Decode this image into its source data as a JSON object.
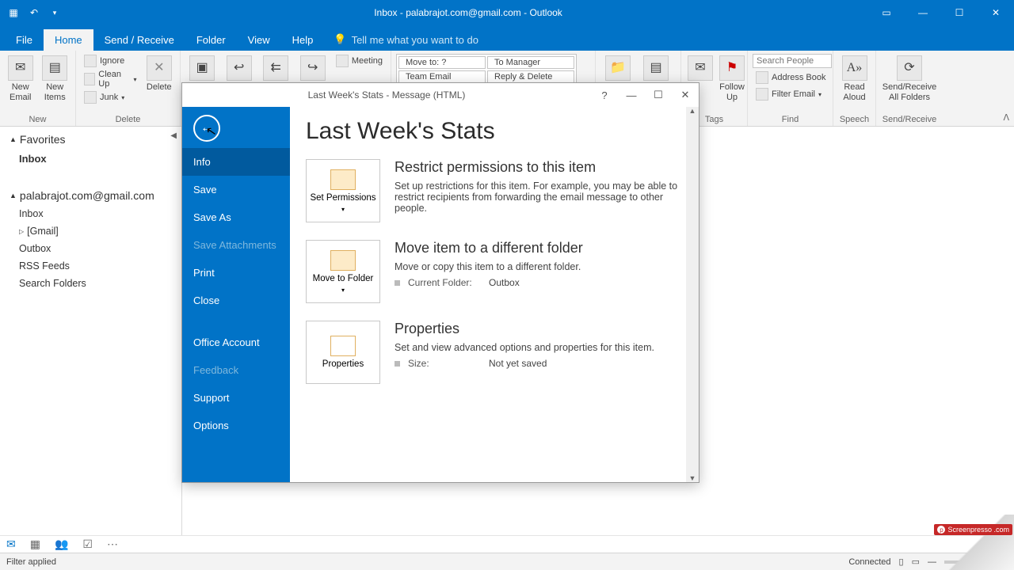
{
  "title": "Inbox - palabrajot.com@gmail.com - Outlook",
  "tabs": {
    "file": "File",
    "home": "Home",
    "sendreceive": "Send / Receive",
    "folder": "Folder",
    "view": "View",
    "help": "Help",
    "tellme": "Tell me what you want to do"
  },
  "ribbon": {
    "new": {
      "email": "New Email",
      "items": "New Items",
      "label": "New"
    },
    "delete": {
      "ignore": "Ignore",
      "cleanup": "Clean Up",
      "junk": "Junk",
      "delete": "Delete",
      "label": "Delete"
    },
    "respond": {
      "meeting": "Meeting"
    },
    "quicksteps": {
      "moveto": "Move to: ?",
      "tomanager": "To Manager",
      "teamemail": "Team Email",
      "replydelete": "Reply & Delete"
    },
    "tags": {
      "followup": "Follow Up",
      "label": "Tags"
    },
    "find": {
      "search_ph": "Search People",
      "addressbook": "Address Book",
      "filter": "Filter Email",
      "label": "Find"
    },
    "speech": {
      "read": "Read Aloud",
      "label": "Speech"
    },
    "sr": {
      "srall": "Send/Receive All Folders",
      "label": "Send/Receive"
    }
  },
  "nav": {
    "favorites": "Favorites",
    "inbox": "Inbox",
    "account": "palabrajot.com@gmail.com",
    "inbox2": "Inbox",
    "gmail": "[Gmail]",
    "outbox": "Outbox",
    "rss": "RSS Feeds",
    "search": "Search Folders"
  },
  "modal": {
    "title": "Last Week's Stats  -  Message (HTML)",
    "back_items": {
      "info": "Info",
      "save": "Save",
      "saveas": "Save As",
      "saveatt": "Save Attachments",
      "print": "Print",
      "close": "Close",
      "account": "Office Account",
      "feedback": "Feedback",
      "support": "Support",
      "options": "Options"
    },
    "heading": "Last Week's Stats",
    "perm": {
      "btn": "Set Permissions",
      "hdr": "Restrict permissions to this item",
      "body": "Set up restrictions for this item. For example, you may be able to restrict recipients from forwarding the email message to other people."
    },
    "move": {
      "btn": "Move to Folder",
      "hdr": "Move item to a different folder",
      "body": "Move or copy this item to a different folder.",
      "k": "Current Folder:",
      "v": "Outbox"
    },
    "props": {
      "btn": "Properties",
      "hdr": "Properties",
      "body": "Set and view advanced options and properties for this item.",
      "k": "Size:",
      "v": "Not yet saved"
    }
  },
  "status": {
    "left": "Filter applied",
    "connected": "Connected"
  },
  "sp": "Screenpresso .com"
}
